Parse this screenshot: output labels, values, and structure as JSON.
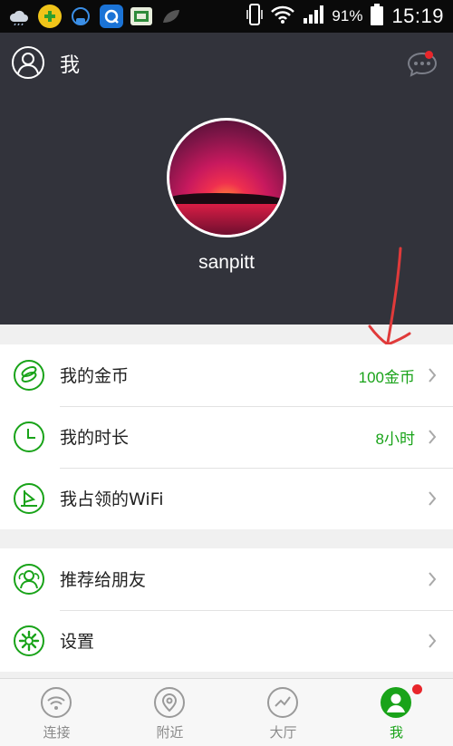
{
  "status_bar": {
    "battery": "91%",
    "time": "15:19"
  },
  "header": {
    "title": "我",
    "username": "sanpitt"
  },
  "menu_groups": [
    {
      "items": [
        {
          "label": "我的金币",
          "value": "100金币",
          "icon": "coins-icon"
        },
        {
          "label": "我的时长",
          "value": "8小时",
          "icon": "clock-icon"
        },
        {
          "label": "我占领的WiFi",
          "value": "",
          "icon": "flag-icon"
        }
      ]
    },
    {
      "items": [
        {
          "label": "推荐给朋友",
          "value": "",
          "icon": "friends-icon"
        },
        {
          "label": "设置",
          "value": "",
          "icon": "gear-icon"
        }
      ]
    }
  ],
  "tab_bar": {
    "tabs": [
      {
        "label": "连接",
        "icon": "wifi-icon"
      },
      {
        "label": "附近",
        "icon": "location-pin-icon"
      },
      {
        "label": "大厅",
        "icon": "hall-icon"
      },
      {
        "label": "我",
        "icon": "me-icon",
        "active": true
      }
    ]
  },
  "colors": {
    "accent": "#19a319",
    "header_bg": "#32333b",
    "badge": "#e8262b",
    "annotation_arrow": "#e03a3a"
  }
}
